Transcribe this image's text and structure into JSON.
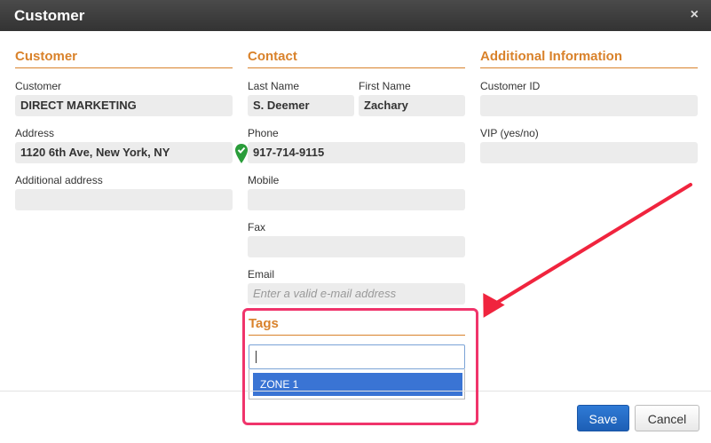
{
  "dialog": {
    "title": "Customer",
    "close_label": "×"
  },
  "sections": {
    "customer": {
      "heading": "Customer",
      "customer_label": "Customer",
      "customer_value": "DIRECT MARKETING",
      "address_label": "Address",
      "address_value": "1120 6th Ave, New York, NY",
      "additional_address_label": "Additional address",
      "additional_address_value": ""
    },
    "contact": {
      "heading": "Contact",
      "last_name_label": "Last Name",
      "last_name_value": "S. Deemer",
      "first_name_label": "First Name",
      "first_name_value": "Zachary",
      "phone_label": "Phone",
      "phone_value": "917-714-9115",
      "mobile_label": "Mobile",
      "mobile_value": "",
      "fax_label": "Fax",
      "fax_value": "",
      "email_label": "Email",
      "email_placeholder": "Enter a valid e-mail address"
    },
    "additional": {
      "heading": "Additional Information",
      "customer_id_label": "Customer ID",
      "customer_id_value": "",
      "vip_label": "VIP (yes/no)",
      "vip_value": ""
    },
    "tags": {
      "heading": "Tags",
      "input_value": "",
      "suggestions": [
        "ZONE 1"
      ]
    }
  },
  "footer": {
    "save_label": "Save",
    "cancel_label": "Cancel"
  },
  "colors": {
    "accent": "#d9822b",
    "primary": "#2f7bd6",
    "highlight": "#f0346b",
    "selection": "#3a74d4",
    "pin": "#2a9d3a"
  }
}
